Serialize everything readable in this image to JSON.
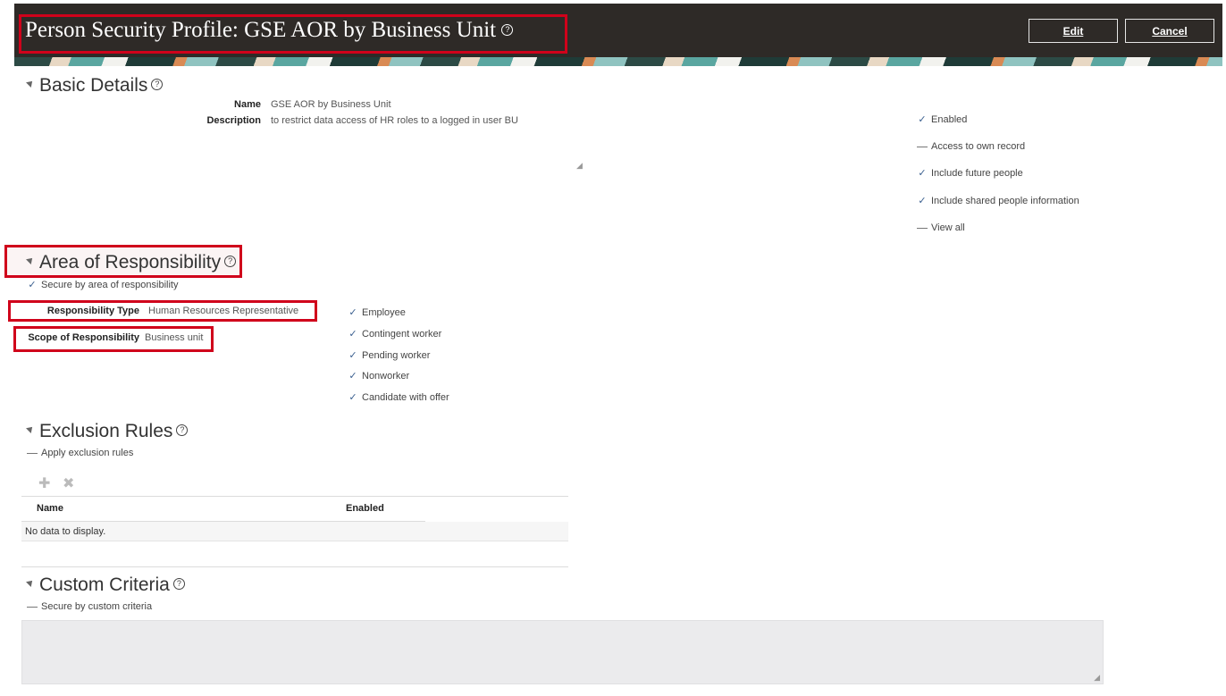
{
  "header": {
    "title": "Person Security Profile: GSE AOR by Business Unit",
    "help_glyph": "?",
    "edit_label": "Edit",
    "cancel_label": "Cancel"
  },
  "basic_details": {
    "heading": "Basic Details",
    "name_label": "Name",
    "name_value": "GSE AOR by Business Unit",
    "description_label": "Description",
    "description_value": "to restrict data access of HR roles to a logged in user BU",
    "options": [
      {
        "label": "Enabled",
        "checked": true
      },
      {
        "label": "Access to own record",
        "checked": false
      },
      {
        "label": "Include future people",
        "checked": true
      },
      {
        "label": "Include shared people information",
        "checked": true
      },
      {
        "label": "View all",
        "checked": false
      }
    ]
  },
  "aor": {
    "heading": "Area of Responsibility",
    "secure_label": "Secure by area of responsibility",
    "secure_checked": true,
    "responsibility_type_label": "Responsibility Type",
    "responsibility_type_value": "Human Resources Representative",
    "scope_label": "Scope of Responsibility",
    "scope_value": "Business unit",
    "person_types": [
      {
        "label": "Employee",
        "checked": true
      },
      {
        "label": "Contingent worker",
        "checked": true
      },
      {
        "label": "Pending worker",
        "checked": true
      },
      {
        "label": "Nonworker",
        "checked": true
      },
      {
        "label": "Candidate with offer",
        "checked": true
      }
    ]
  },
  "exclusion": {
    "heading": "Exclusion Rules",
    "apply_label": "Apply exclusion rules",
    "apply_checked": false,
    "columns": [
      "Name",
      "Enabled"
    ],
    "empty_text": "No data to display."
  },
  "custom": {
    "heading": "Custom Criteria",
    "secure_label": "Secure by custom criteria",
    "secure_checked": false
  },
  "colors": {
    "header_bg": "#2e2a27",
    "highlight": "#d0021b",
    "check": "#3a5f8f"
  },
  "icons": {
    "add": "plus-icon",
    "remove": "x-icon",
    "help": "help-icon",
    "collapse": "collapse-triangle-icon"
  }
}
